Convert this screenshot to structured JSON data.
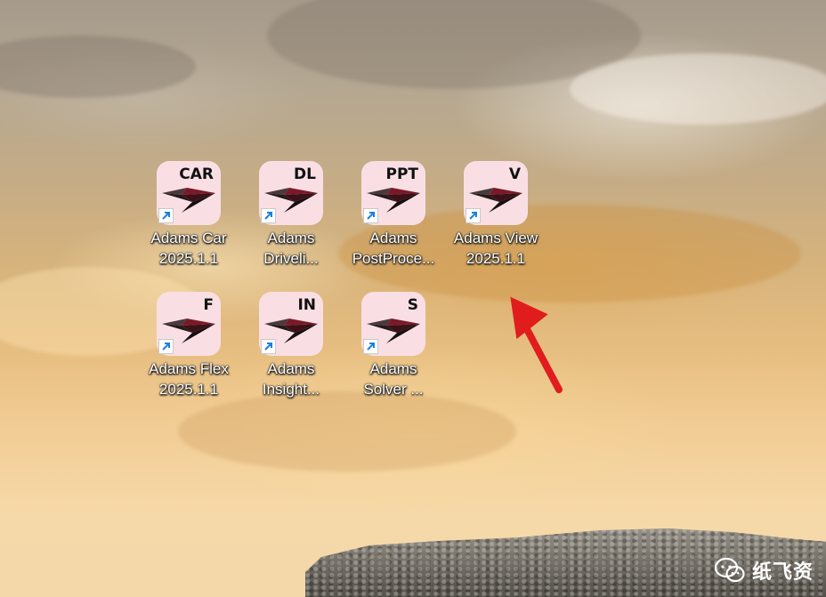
{
  "desktop": {
    "icons": [
      {
        "code": "CAR",
        "label_line1": "Adams Car",
        "label_line2": "2025.1.1"
      },
      {
        "code": "DL",
        "label_line1": "Adams",
        "label_line2": "Driveli..."
      },
      {
        "code": "PPT",
        "label_line1": "Adams",
        "label_line2": "PostProce..."
      },
      {
        "code": "V",
        "label_line1": "Adams View",
        "label_line2": "2025.1.1"
      },
      {
        "code": "F",
        "label_line1": "Adams Flex",
        "label_line2": "2025.1.1"
      },
      {
        "code": "IN",
        "label_line1": "Adams",
        "label_line2": "Insight..."
      },
      {
        "code": "S",
        "label_line1": "Adams",
        "label_line2": "Solver ..."
      }
    ],
    "icon_tile_color": "#f9dfe3",
    "annotation_arrow_color": "#e11c1c",
    "shortcut_overlay_icon": "shortcut-arrow-icon"
  },
  "watermark": {
    "icon": "wechat-icon",
    "text": "纸飞资"
  }
}
